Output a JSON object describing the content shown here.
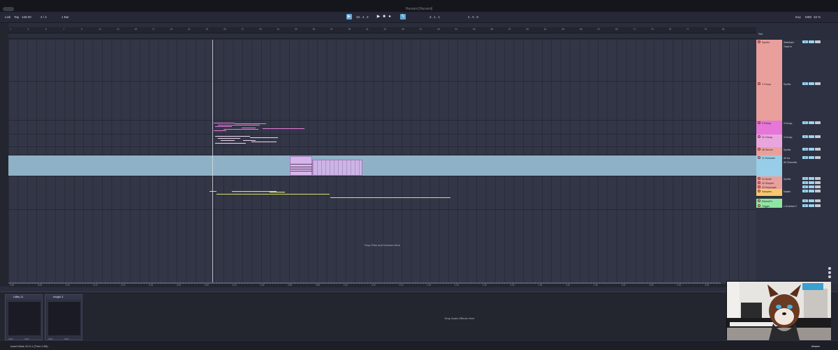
{
  "window": {
    "title": "Hanami [Hanami]"
  },
  "control": {
    "link": "Link",
    "tap": "Tap",
    "tempo": "128.00",
    "signature": "4 / 4",
    "quantize": "1 Bar",
    "position": "33 . 4 . 3",
    "loop_start": "3 . 1 . 1",
    "loop_length": "4 . 0 . 0",
    "key": "Key",
    "midi": "MIDI",
    "cpu": "33 %"
  },
  "ruler": {
    "ticks": [
      "1",
      "3",
      "5",
      "7",
      "9",
      "11",
      "13",
      "15",
      "17",
      "19",
      "21",
      "23",
      "25",
      "27",
      "29",
      "31",
      "33",
      "35",
      "37",
      "39",
      "41",
      "43",
      "45",
      "47",
      "49",
      "51",
      "53",
      "55",
      "57",
      "59",
      "61",
      "63",
      "65",
      "67",
      "69",
      "71",
      "73",
      "75",
      "77",
      "79",
      "81"
    ]
  },
  "time": {
    "ticks": [
      "0:00",
      "0:05",
      "0:10",
      "0:15",
      "0:20",
      "0:25",
      "0:30",
      "0:35",
      "0:40",
      "0:45",
      "0:50",
      "0:55",
      "1:00",
      "1:05",
      "1:10",
      "1:15",
      "1:20",
      "1:25",
      "1:30",
      "1:35",
      "1:40",
      "1:45",
      "1:50",
      "1:55",
      "2:00",
      "2:05"
    ]
  },
  "arrangement": {
    "drop_hint": "Drop Files and Devices Here"
  },
  "set_label": "Set",
  "tracks": [
    {
      "name": "Synths",
      "color": "#e9a09c",
      "route": "Sidechain",
      "route2": "Track In",
      "vol": "0"
    },
    {
      "name": "2 Group",
      "color": "#e9a09c",
      "route": "Synths",
      "route2": "",
      "vol": "0"
    },
    {
      "name": "3 Group",
      "color": "#e676d7",
      "route": "3-Group",
      "route2": "",
      "vol": "0"
    },
    {
      "name": "31 Group",
      "color": "#e9a6de",
      "route": "3-Group",
      "route2": "",
      "vol": "0"
    },
    {
      "name": "38 Serum",
      "color": "#e9a09c",
      "route": "Synths",
      "route2": "",
      "vol": "-0"
    },
    {
      "name": "31 Kickstart",
      "color": "#98cde8",
      "route": "All Ins",
      "route2": "All Channels",
      "vol": "-0"
    },
    {
      "name": "41 Audio",
      "color": "#e9a09c",
      "route": "Synths",
      "route2": "",
      "vol": "0"
    },
    {
      "name": "42 Simpler",
      "color": "#e9a09c",
      "route": "",
      "route2": "",
      "vol": "0"
    },
    {
      "name": "43 Keyscape",
      "color": "#e9a09c",
      "route": "",
      "route2": "",
      "vol": "0"
    },
    {
      "name": "Samples",
      "color": "#f6c86b",
      "route": "Master",
      "route2": "",
      "vol": "0"
    },
    {
      "name": "Risers/Fx",
      "color": "#8ee6a3",
      "route": "",
      "route2": "",
      "vol": "0"
    },
    {
      "name": "Trigger",
      "color": "#8ee6a3",
      "route": "1-Kickstart 2",
      "route2": "",
      "vol": "0"
    }
  ],
  "devices": [
    {
      "name": "Utility 11",
      "left": "none",
      "right": "none"
    },
    {
      "name": "Insight 3",
      "left": "none",
      "right": "none"
    }
  ],
  "device_panel": {
    "drop_hint": "Drop Audio Effects Here"
  },
  "status": {
    "text": "Insert Mark 33.3.1 (Time 0:58)",
    "master": "Master"
  }
}
